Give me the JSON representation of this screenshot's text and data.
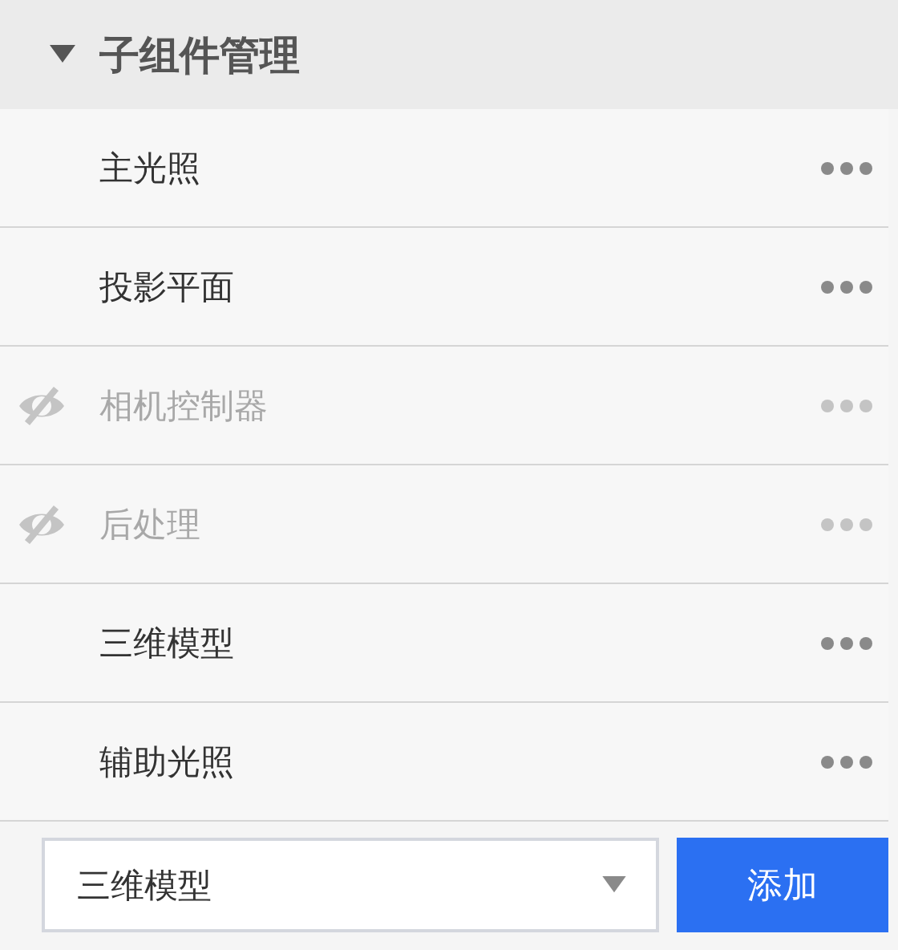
{
  "section": {
    "title": "子组件管理",
    "expanded": true
  },
  "items": [
    {
      "name": "主光照",
      "visible": true
    },
    {
      "name": "投影平面",
      "visible": true
    },
    {
      "name": "相机控制器",
      "visible": false
    },
    {
      "name": "后处理",
      "visible": false
    },
    {
      "name": "三维模型",
      "visible": true
    },
    {
      "name": "辅助光照",
      "visible": true
    }
  ],
  "add_bar": {
    "select_value": "三维模型",
    "button": "添加"
  }
}
